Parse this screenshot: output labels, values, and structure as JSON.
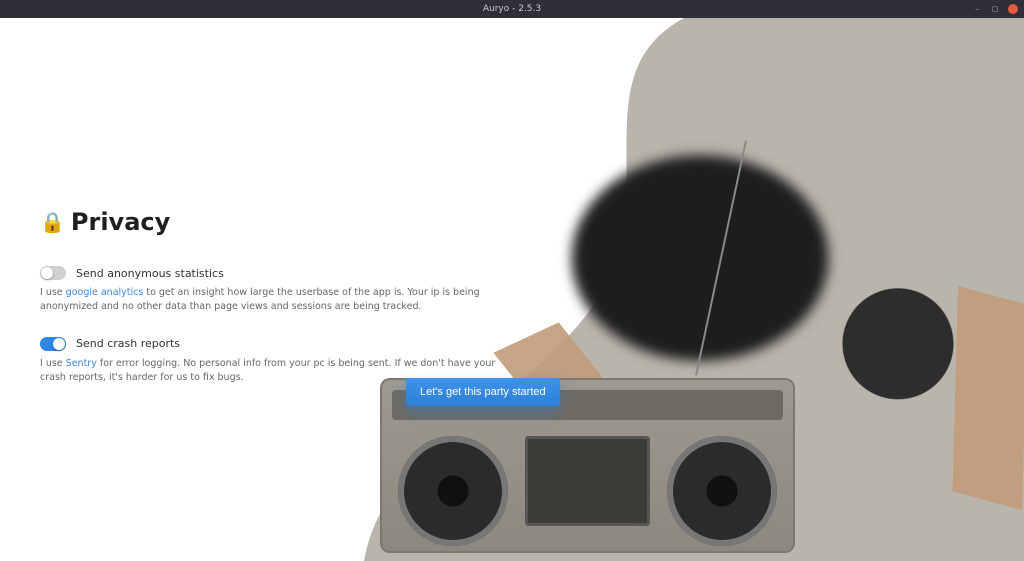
{
  "window": {
    "title": "Auryo - 2.5.3"
  },
  "page": {
    "heading": "Privacy"
  },
  "settings": {
    "anon": {
      "label": "Send anonymous statistics",
      "enabled": false,
      "desc_pre": "I use ",
      "desc_link": "google analytics",
      "desc_post": " to get an insight how large the userbase of the app is. Your ip is being anonymized and no other data than page views and sessions are being tracked."
    },
    "crash": {
      "label": "Send crash reports",
      "enabled": true,
      "desc_pre": "I use ",
      "desc_link": "Sentry",
      "desc_post": " for error logging. No personal info from your pc is being sent. If we don't have your crash reports, it's harder for us to fix bugs."
    }
  },
  "cta": {
    "label": "Let's get this party started"
  }
}
